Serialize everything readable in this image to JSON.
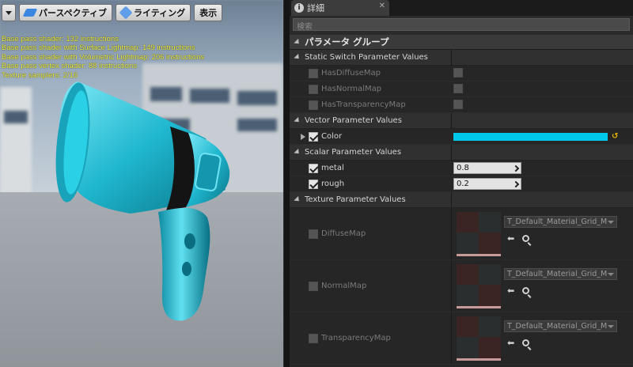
{
  "viewport": {
    "toolbar": {
      "perspective_label": "パースペクティブ",
      "lighting_label": "ライティング",
      "show_label": "表示"
    },
    "stats": [
      "Base pass shader: 132 instructions",
      "Base pass shader with Surface Lightmap: 149 instructions",
      "Base pass shader with Volumetric Lightmap: 206 instructions",
      "Base pass vertex shader: 88 instructions",
      "Texture samplers: 2/16"
    ]
  },
  "panel": {
    "tab_label": "詳細",
    "search_placeholder": "検索",
    "group_title": "パラメータ グループ",
    "sections": {
      "static_switch": "Static Switch Parameter Values",
      "vector": "Vector Parameter Values",
      "scalar": "Scalar Parameter Values",
      "texture": "Texture Parameter Values"
    },
    "static_switch_params": [
      "HasDiffuseMap",
      "HasNormalMap",
      "HasTransparencyMap"
    ],
    "vector_param": {
      "name": "Color",
      "color": "#00c8ea"
    },
    "scalar_params": [
      {
        "name": "metal",
        "value": "0.8"
      },
      {
        "name": "rough",
        "value": "0.2"
      }
    ],
    "texture_params": [
      {
        "name": "DiffuseMap",
        "asset": "T_Default_Material_Grid_M"
      },
      {
        "name": "NormalMap",
        "asset": "T_Default_Material_Grid_M"
      },
      {
        "name": "TransparencyMap",
        "asset": "T_Default_Material_Grid_M"
      }
    ]
  }
}
